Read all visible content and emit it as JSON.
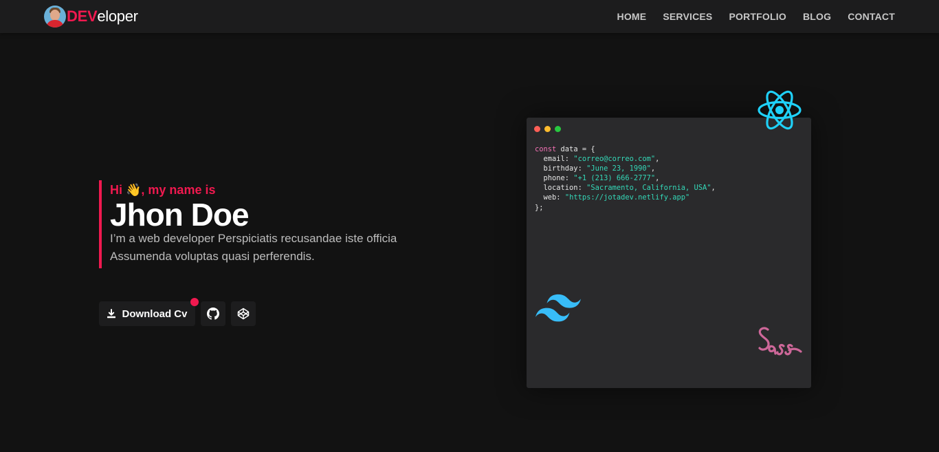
{
  "brand": {
    "accent": "DEV",
    "rest": "eloper"
  },
  "nav": {
    "items": [
      {
        "label": "HOME"
      },
      {
        "label": "SERVICES"
      },
      {
        "label": "PORTFOLIO"
      },
      {
        "label": "BLOG"
      },
      {
        "label": "CONTACT"
      }
    ]
  },
  "hero": {
    "greeting": "Hi 👋, my name is",
    "name": "Jhon Doe",
    "description": "I’m a web developer Perspiciatis recusandae iste officia Assumenda voluptas quasi perferendis."
  },
  "actions": {
    "download_label": "Download Cv",
    "github_icon": "github-icon",
    "codepen_icon": "codepen-icon"
  },
  "code": {
    "decl": "const",
    "var_name": "data = {",
    "fields": [
      {
        "key": "email",
        "value": "\"correo@correo.com\""
      },
      {
        "key": "birthday",
        "value": "\"June 23, 1990\""
      },
      {
        "key": "phone",
        "value": "\"+1 (213) 666-2777\""
      },
      {
        "key": "location",
        "value": "\"Sacramento, California, USA\""
      },
      {
        "key": "web",
        "value": "\"https://jotadev.netlify.app\""
      }
    ],
    "closing": "};"
  },
  "colors": {
    "accent": "#f0194f",
    "background": "#121212",
    "header": "#1c1c1d",
    "card": "#2a2a2c",
    "react": "#1fd1f9",
    "tailwind": "#38bdf8",
    "sass": "#cd6799",
    "window_dots": [
      "#ff5f57",
      "#febc2e",
      "#28c840"
    ]
  },
  "icons": [
    "react-icon",
    "tailwind-icon",
    "sass-icon",
    "download-icon",
    "github-icon",
    "codepen-icon"
  ]
}
